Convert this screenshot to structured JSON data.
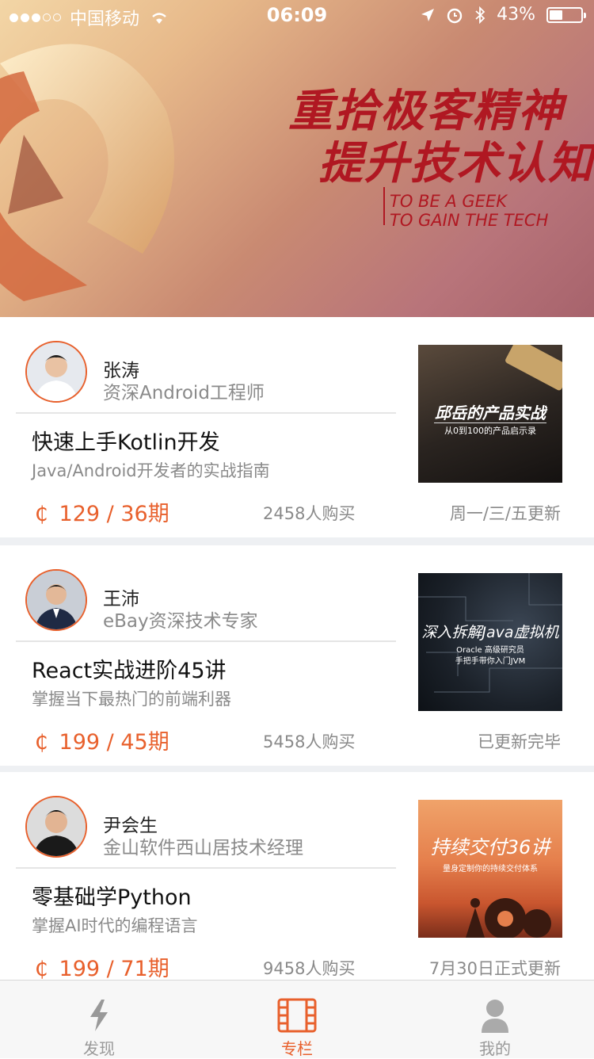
{
  "status_bar": {
    "carrier": "中国移动",
    "time": "06:09",
    "battery_text": "43%",
    "battery_level": 0.43
  },
  "banner": {
    "slogan_line1": "重拾极客精神",
    "slogan_line2": "提升技术认知",
    "english_line1": "TO BE A GEEK",
    "english_line2": "TO GAIN THE TECH"
  },
  "cards": [
    {
      "author_name": "张涛",
      "author_title": "资深Android工程师",
      "course_title": "快速上手Kotlin开发",
      "course_desc": "Java/Android开发者的实战指南",
      "price": "129 / 36期",
      "buyers": "2458人购买",
      "update": "周一/三/五更新",
      "cover_title": "邱岳的产品实战",
      "cover_subtitle": "从0到100的产品启示录"
    },
    {
      "author_name": "王沛",
      "author_title": "eBay资深技术专家",
      "course_title": "React实战进阶45讲",
      "course_desc": "掌握当下最热门的前端利器",
      "price": "199 / 45期",
      "buyers": "5458人购买",
      "update": "已更新完毕",
      "cover_title": "深入拆解Java虚拟机",
      "cover_subtitle": "Oracle 高级研究员",
      "cover_subtitle2": "手把手带你入门JVM"
    },
    {
      "author_name": "尹会生",
      "author_title": "金山软件西山居技术经理",
      "course_title": "零基础学Python",
      "course_desc": "掌握AI时代的编程语言",
      "price": "199 / 71期",
      "buyers": "9458人购买",
      "update": "7月30日正式更新",
      "cover_title": "持续交付36讲",
      "cover_subtitle": "量身定制你的持续交付体系"
    }
  ],
  "tabbar": {
    "items": [
      {
        "label": "发现",
        "icon": "lightning-icon",
        "active": false
      },
      {
        "label": "专栏",
        "icon": "film-icon",
        "active": true
      },
      {
        "label": "我的",
        "icon": "person-icon",
        "active": false
      }
    ]
  },
  "colors": {
    "accent": "#e8602c",
    "banner_text": "#b01822",
    "muted": "#8a8a8a"
  }
}
